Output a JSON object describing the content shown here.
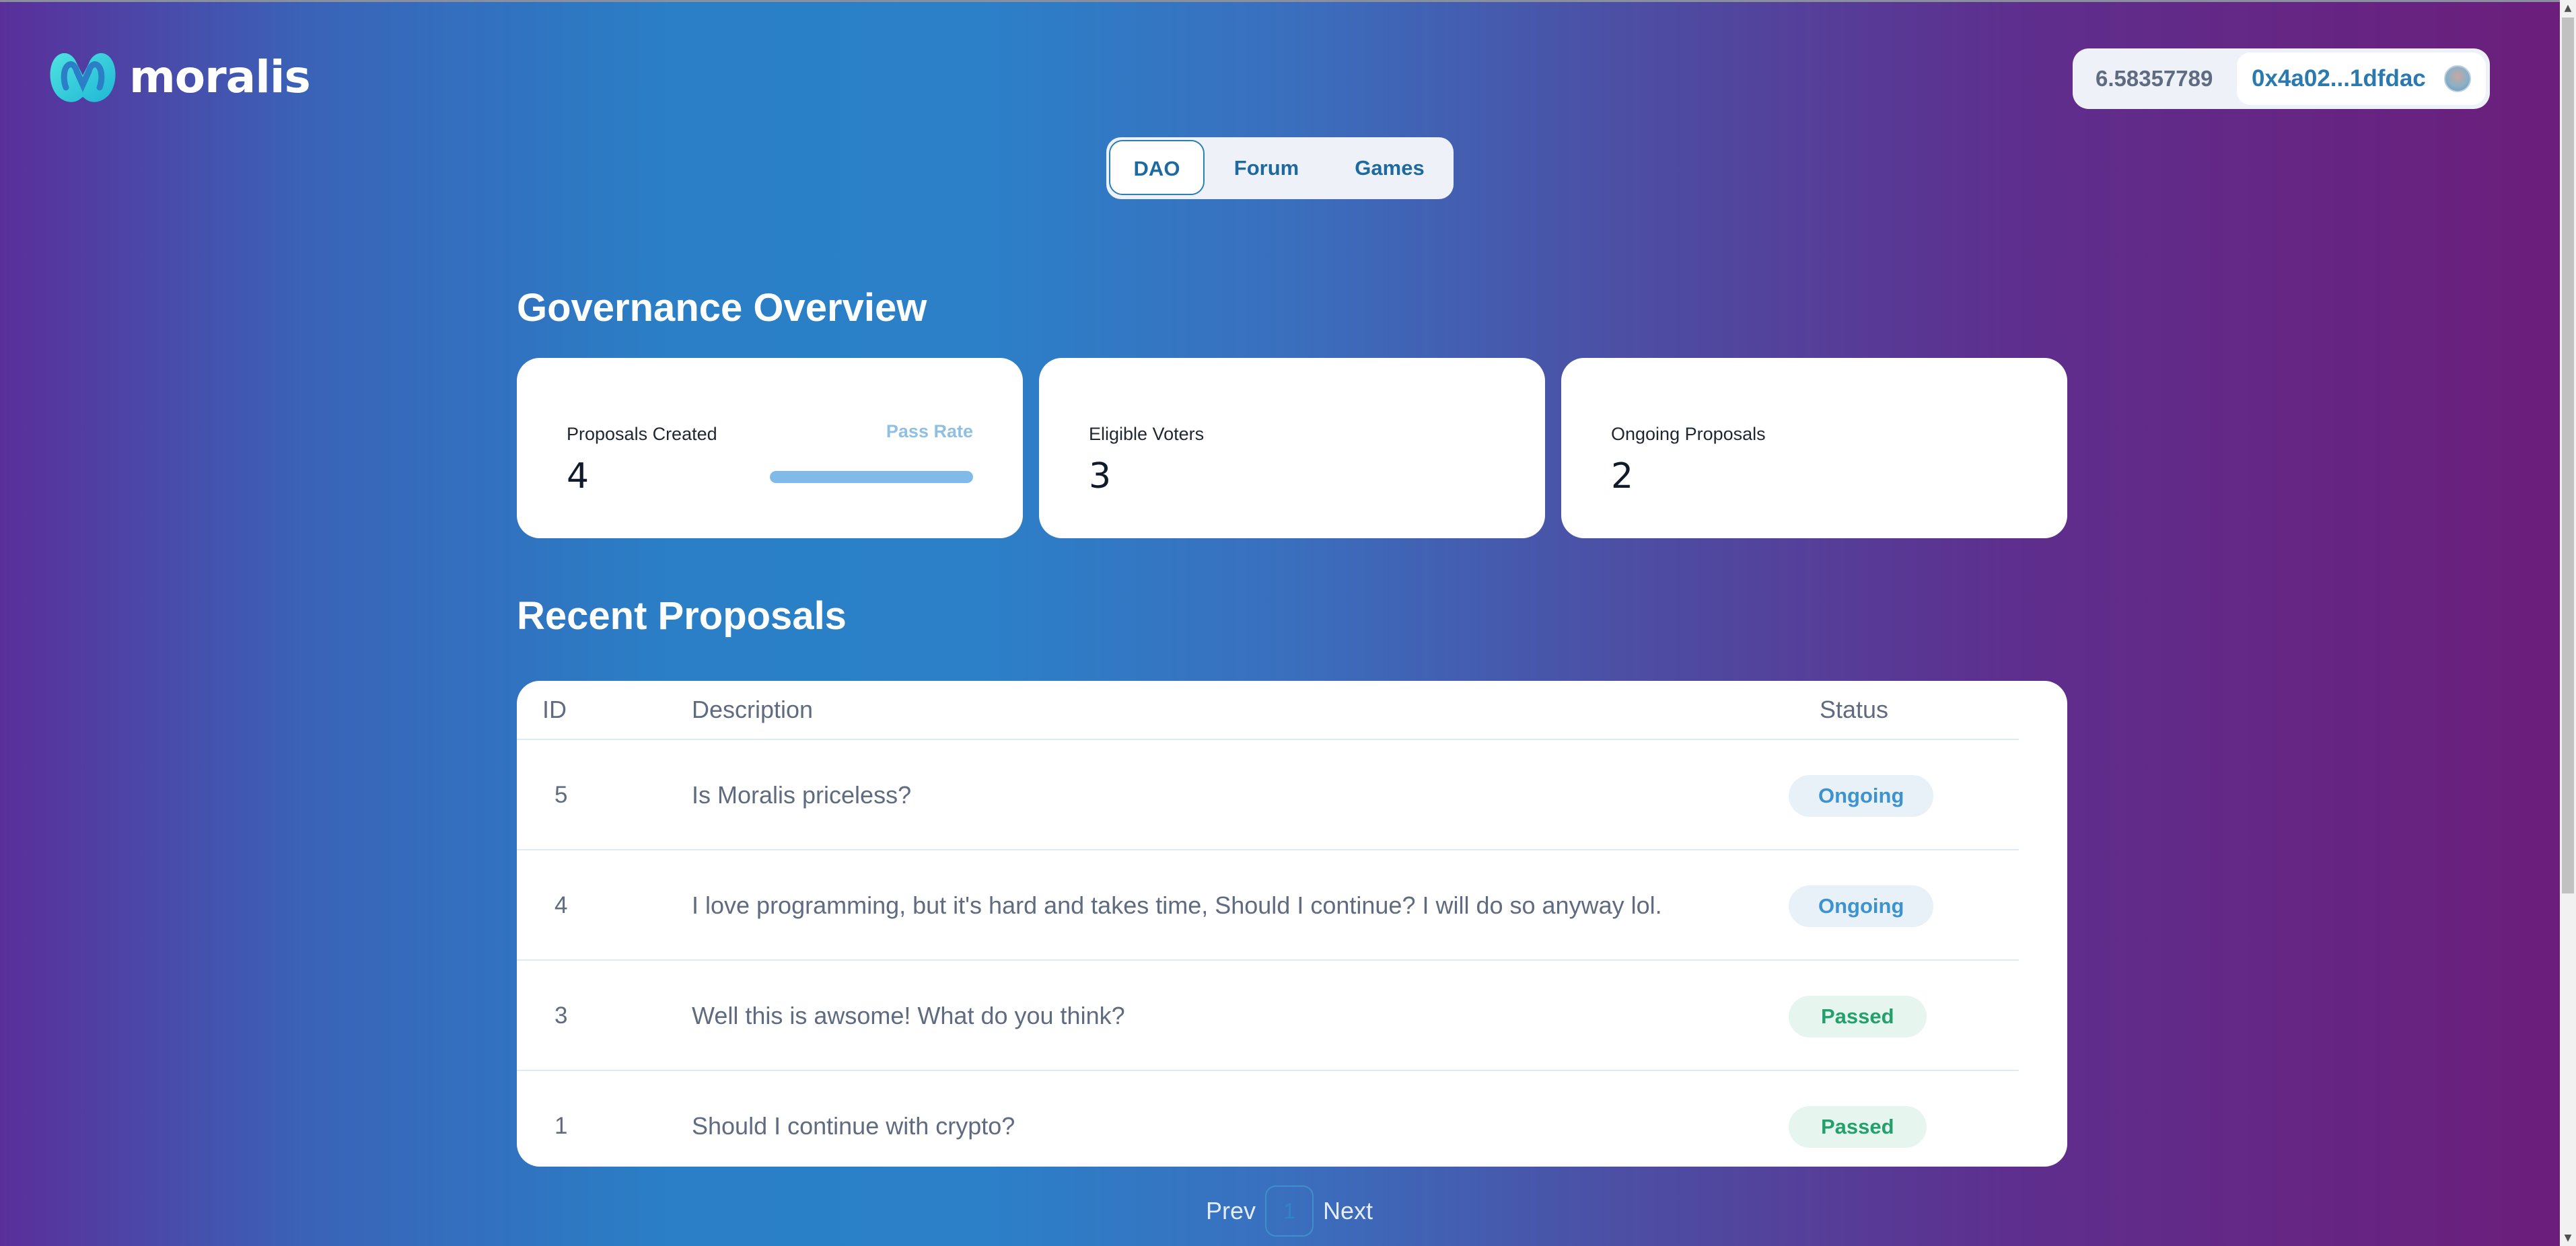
{
  "brand": {
    "name": "moralis"
  },
  "account": {
    "balance": "6.58357789",
    "address": "0x4a02...1dfdac"
  },
  "tabs": [
    {
      "label": "DAO",
      "active": true
    },
    {
      "label": "Forum",
      "active": false
    },
    {
      "label": "Games",
      "active": false
    }
  ],
  "overview": {
    "title": "Governance Overview",
    "cards": [
      {
        "label": "Proposals Created",
        "value": "4",
        "pass_rate_label": "Pass Rate",
        "pass_rate_fraction": 1.0
      },
      {
        "label": "Eligible Voters",
        "value": "3"
      },
      {
        "label": "Ongoing Proposals",
        "value": "2"
      }
    ]
  },
  "proposals": {
    "title": "Recent Proposals",
    "columns": [
      "ID",
      "Description",
      "Status"
    ],
    "rows": [
      {
        "id": "5",
        "description": "Is Moralis priceless?",
        "status": "Ongoing"
      },
      {
        "id": "4",
        "description": "I love programming, but it's hard and takes time, Should I continue? I will do so anyway lol.",
        "status": "Ongoing"
      },
      {
        "id": "3",
        "description": "Well this is awsome! What do you think?",
        "status": "Passed"
      },
      {
        "id": "1",
        "description": "Should I continue with crypto?",
        "status": "Passed"
      }
    ]
  },
  "pagination": {
    "prev": "Prev",
    "page": "1",
    "next": "Next"
  },
  "icons": {
    "logo": "moralis-logo-icon",
    "avatar": "wallet-avatar-icon"
  },
  "colors": {
    "ongoing_badge_text": "#3d93cf",
    "passed_badge_text": "#23a06b",
    "accent": "#2a7fb8"
  }
}
